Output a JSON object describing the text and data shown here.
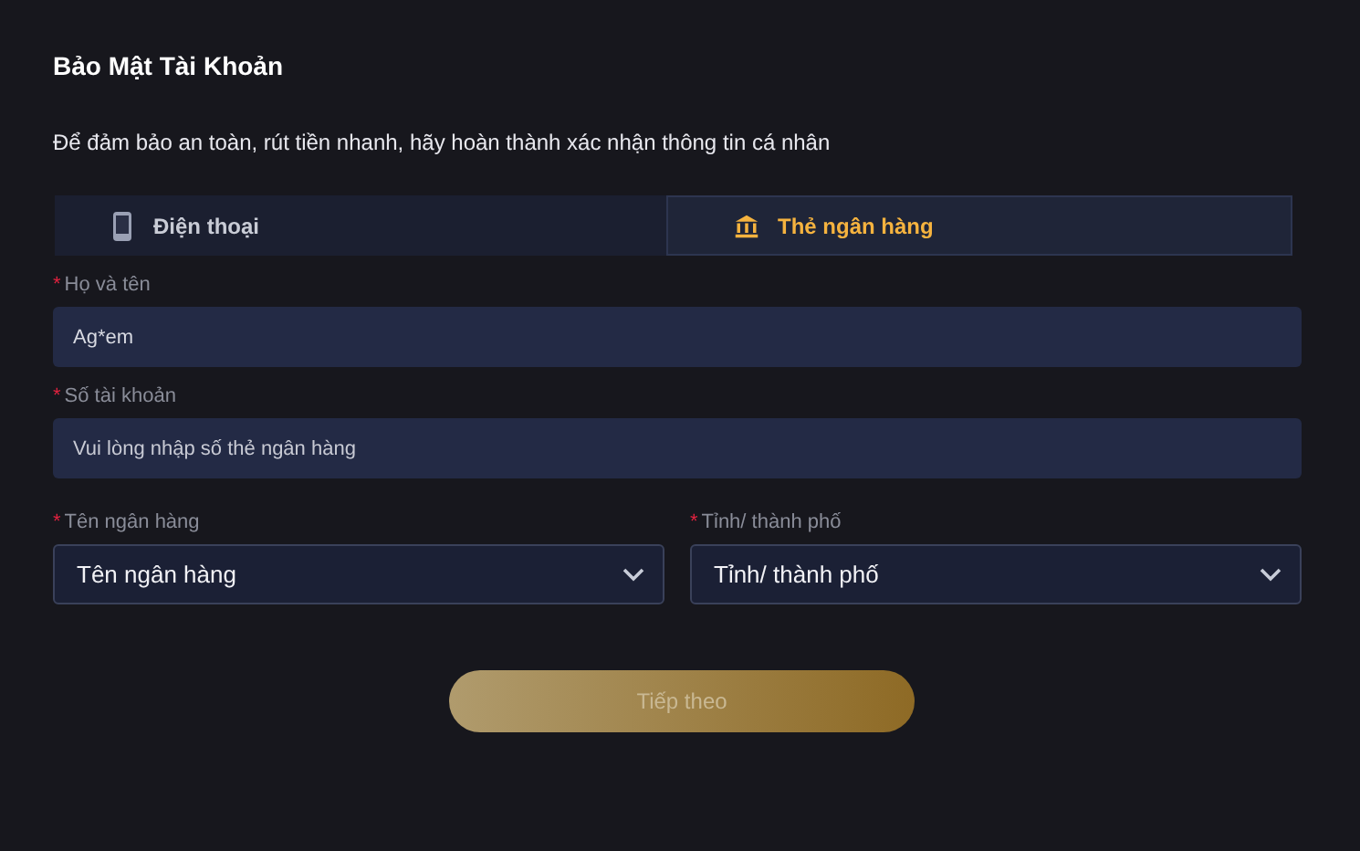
{
  "title": "Bảo Mật Tài Khoản",
  "subtitle": "Để đảm bảo an toàn, rút tiền nhanh, hãy hoàn thành xác nhận thông tin cá nhân",
  "tabs": [
    {
      "label": "Điện thoại",
      "kind": "phone",
      "selected": false
    },
    {
      "label": "Thẻ ngân hàng",
      "kind": "bank",
      "selected": true
    }
  ],
  "fields": [
    {
      "mark": "*",
      "label": "Họ và tên",
      "value": "Ag*em"
    },
    {
      "mark": "*",
      "label": "Số tài khoản",
      "placeholder": "Vui lòng nhập số thẻ ngân hàng"
    }
  ],
  "selects": [
    {
      "mark": "*",
      "label": "Tên ngân hàng",
      "placeholder": "Tên ngân hàng"
    },
    {
      "mark": "*",
      "label": "Tỉnh/ thành phố",
      "placeholder": "Tỉnh/ thành phố"
    }
  ],
  "submit": {
    "label": "Tiếp theo",
    "disabled": true
  }
}
